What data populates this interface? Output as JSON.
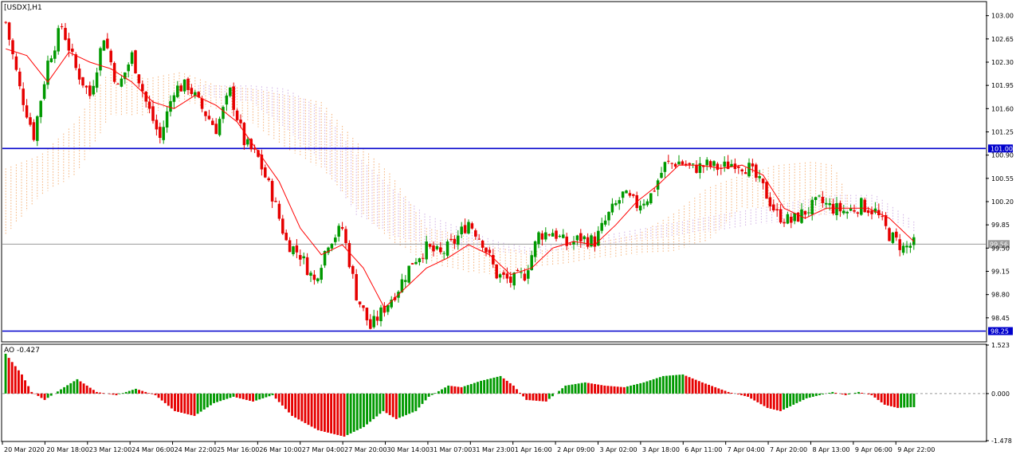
{
  "chart_data": [
    {
      "type": "candlestick",
      "title": "[USDX],H1",
      "ylim": [
        98.1,
        103.2
      ],
      "y_ticks": [
        103.0,
        102.65,
        102.3,
        101.95,
        101.6,
        101.25,
        100.9,
        100.55,
        100.2,
        99.85,
        99.5,
        99.15,
        98.8,
        98.45
      ],
      "y_tick_labels": [
        "103.00",
        "102.65",
        "102.30",
        "101.95",
        "101.60",
        "101.25",
        "100.90",
        "100.55",
        "100.20",
        "99.85",
        "99.50",
        "99.15",
        "98.80",
        "98.45"
      ],
      "x_labels": [
        "20 Mar 2020",
        "20 Mar 18:00",
        "23 Mar 12:00",
        "24 Mar 06:00",
        "24 Mar 22:00",
        "25 Mar 16:00",
        "26 Mar 10:00",
        "27 Mar 04:00",
        "27 Mar 20:00",
        "30 Mar 14:00",
        "31 Mar 07:00",
        "31 Mar 23:00",
        "1 Apr 16:00",
        "2 Apr 09:00",
        "3 Apr 02:00",
        "3 Apr 18:00",
        "6 Apr 11:00",
        "7 Apr 04:00",
        "7 Apr 20:00",
        "8 Apr 13:00",
        "9 Apr 06:00",
        "9 Apr 22:00"
      ],
      "horizontal_levels": [
        {
          "label": "101.00",
          "value": 101.0,
          "color": "#0000cc"
        },
        {
          "label": "98.25",
          "value": 98.25,
          "color": "#0000cc"
        }
      ],
      "current_price": {
        "label": "99.56",
        "value": 99.56
      },
      "colors": {
        "up": "#009900",
        "down": "#e60000",
        "ma": "#ff0000",
        "cloud_a": "#f4a460",
        "cloud_b": "#c8a2e0"
      },
      "close_path": [
        [
          0,
          102.9
        ],
        [
          4,
          101.9
        ],
        [
          8,
          101.2
        ],
        [
          12,
          102.3
        ],
        [
          16,
          102.85
        ],
        [
          20,
          102.2
        ],
        [
          24,
          101.8
        ],
        [
          28,
          102.7
        ],
        [
          32,
          101.9
        ],
        [
          36,
          102.4
        ],
        [
          40,
          101.7
        ],
        [
          44,
          101.15
        ],
        [
          48,
          101.9
        ],
        [
          52,
          101.95
        ],
        [
          56,
          101.6
        ],
        [
          60,
          101.3
        ],
        [
          64,
          101.85
        ],
        [
          68,
          101.1
        ],
        [
          72,
          100.85
        ],
        [
          76,
          100.3
        ],
        [
          80,
          99.6
        ],
        [
          84,
          99.4
        ],
        [
          88,
          99.0
        ],
        [
          92,
          99.6
        ],
        [
          96,
          99.8
        ],
        [
          100,
          98.8
        ],
        [
          104,
          98.3
        ],
        [
          108,
          98.6
        ],
        [
          112,
          98.9
        ],
        [
          116,
          99.3
        ],
        [
          120,
          99.5
        ],
        [
          124,
          99.4
        ],
        [
          128,
          99.6
        ],
        [
          132,
          99.9
        ],
        [
          136,
          99.6
        ],
        [
          140,
          99.1
        ],
        [
          144,
          99.0
        ],
        [
          148,
          99.1
        ],
        [
          152,
          99.7
        ],
        [
          156,
          99.75
        ],
        [
          160,
          99.55
        ],
        [
          164,
          99.65
        ],
        [
          168,
          99.6
        ],
        [
          172,
          100.0
        ],
        [
          176,
          100.3
        ],
        [
          180,
          100.15
        ],
        [
          184,
          100.3
        ],
        [
          188,
          100.75
        ],
        [
          192,
          100.8
        ],
        [
          196,
          100.7
        ],
        [
          200,
          100.75
        ],
        [
          204,
          100.7
        ],
        [
          208,
          100.8
        ],
        [
          212,
          100.7
        ],
        [
          216,
          100.4
        ],
        [
          220,
          100.0
        ],
        [
          224,
          99.9
        ],
        [
          228,
          100.05
        ],
        [
          232,
          100.2
        ],
        [
          236,
          100.1
        ],
        [
          240,
          100.05
        ],
        [
          244,
          100.15
        ],
        [
          248,
          100.05
        ],
        [
          252,
          99.7
        ],
        [
          256,
          99.5
        ],
        [
          259,
          99.56
        ]
      ],
      "ma_path": [
        [
          0,
          102.5
        ],
        [
          6,
          102.4
        ],
        [
          12,
          102.0
        ],
        [
          18,
          102.45
        ],
        [
          24,
          102.3
        ],
        [
          30,
          102.2
        ],
        [
          36,
          102.0
        ],
        [
          42,
          101.7
        ],
        [
          48,
          101.6
        ],
        [
          54,
          101.8
        ],
        [
          60,
          101.65
        ],
        [
          66,
          101.4
        ],
        [
          72,
          100.95
        ],
        [
          78,
          100.5
        ],
        [
          84,
          99.8
        ],
        [
          90,
          99.4
        ],
        [
          96,
          99.55
        ],
        [
          102,
          99.2
        ],
        [
          108,
          98.6
        ],
        [
          114,
          98.9
        ],
        [
          120,
          99.2
        ],
        [
          126,
          99.35
        ],
        [
          132,
          99.55
        ],
        [
          138,
          99.4
        ],
        [
          144,
          99.1
        ],
        [
          150,
          99.2
        ],
        [
          156,
          99.5
        ],
        [
          162,
          99.6
        ],
        [
          168,
          99.55
        ],
        [
          174,
          99.85
        ],
        [
          180,
          100.2
        ],
        [
          186,
          100.45
        ],
        [
          192,
          100.75
        ],
        [
          198,
          100.75
        ],
        [
          204,
          100.7
        ],
        [
          210,
          100.75
        ],
        [
          216,
          100.6
        ],
        [
          222,
          100.1
        ],
        [
          228,
          99.95
        ],
        [
          234,
          100.1
        ],
        [
          240,
          100.1
        ],
        [
          246,
          100.1
        ],
        [
          252,
          99.95
        ],
        [
          259,
          99.6
        ]
      ],
      "cloud_a_upper": [
        [
          0,
          100.7
        ],
        [
          10,
          100.9
        ],
        [
          20,
          101.4
        ],
        [
          30,
          102.2
        ],
        [
          40,
          102.05
        ],
        [
          50,
          102.15
        ],
        [
          60,
          101.95
        ],
        [
          70,
          101.9
        ],
        [
          80,
          101.8
        ],
        [
          90,
          101.7
        ],
        [
          100,
          101.1
        ],
        [
          110,
          100.6
        ],
        [
          120,
          99.8
        ],
        [
          130,
          99.7
        ],
        [
          140,
          99.5
        ],
        [
          150,
          99.45
        ],
        [
          160,
          99.5
        ],
        [
          170,
          99.6
        ],
        [
          180,
          99.7
        ],
        [
          190,
          100.0
        ],
        [
          200,
          100.4
        ],
        [
          210,
          100.6
        ],
        [
          220,
          100.75
        ],
        [
          230,
          100.8
        ],
        [
          236,
          100.75
        ],
        [
          240,
          100.3
        ]
      ],
      "cloud_a_lower": [
        [
          0,
          99.7
        ],
        [
          10,
          100.3
        ],
        [
          20,
          100.6
        ],
        [
          30,
          101.5
        ],
        [
          40,
          101.5
        ],
        [
          50,
          101.7
        ],
        [
          60,
          101.6
        ],
        [
          70,
          101.4
        ],
        [
          80,
          101.0
        ],
        [
          90,
          100.7
        ],
        [
          100,
          100.1
        ],
        [
          110,
          99.6
        ],
        [
          120,
          99.3
        ],
        [
          130,
          99.15
        ],
        [
          140,
          99.1
        ],
        [
          150,
          99.2
        ],
        [
          160,
          99.25
        ],
        [
          170,
          99.35
        ],
        [
          180,
          99.4
        ],
        [
          190,
          99.45
        ],
        [
          200,
          99.6
        ],
        [
          210,
          100.1
        ],
        [
          220,
          100.1
        ],
        [
          230,
          100.0
        ],
        [
          236,
          100.0
        ],
        [
          240,
          100.0
        ]
      ],
      "cloud_b_upper": [
        [
          55,
          101.95
        ],
        [
          70,
          101.95
        ],
        [
          80,
          101.9
        ],
        [
          90,
          101.6
        ],
        [
          100,
          100.9
        ],
        [
          110,
          100.4
        ],
        [
          120,
          100.0
        ],
        [
          130,
          99.8
        ],
        [
          140,
          99.6
        ],
        [
          150,
          99.5
        ],
        [
          236,
          100.3
        ],
        [
          248,
          100.3
        ],
        [
          259,
          99.9
        ]
      ],
      "cloud_b_lower": [
        [
          55,
          101.8
        ],
        [
          70,
          101.7
        ],
        [
          80,
          101.3
        ],
        [
          90,
          100.8
        ],
        [
          100,
          100.0
        ],
        [
          110,
          99.7
        ],
        [
          120,
          99.55
        ],
        [
          130,
          99.5
        ],
        [
          140,
          99.45
        ],
        [
          150,
          99.4
        ],
        [
          236,
          100.0
        ],
        [
          248,
          100.05
        ],
        [
          259,
          99.75
        ]
      ]
    },
    {
      "type": "bar",
      "title": "AO -0.427",
      "ylim": [
        -1.478,
        1.523
      ],
      "y_tick_labels": [
        "1.523",
        "0.000",
        "-1.478"
      ],
      "y_ticks": [
        1.523,
        0.0,
        -1.478
      ],
      "zero_line": 0.0,
      "last_value": -0.427,
      "colors": {
        "up": "#009900",
        "down": "#e60000"
      },
      "values_path": [
        [
          0,
          1.25
        ],
        [
          5,
          0.6
        ],
        [
          8,
          0.05
        ],
        [
          12,
          -0.2
        ],
        [
          18,
          0.2
        ],
        [
          22,
          0.45
        ],
        [
          28,
          0.05
        ],
        [
          34,
          -0.05
        ],
        [
          40,
          0.15
        ],
        [
          46,
          -0.05
        ],
        [
          52,
          -0.55
        ],
        [
          58,
          -0.7
        ],
        [
          64,
          -0.3
        ],
        [
          70,
          -0.1
        ],
        [
          76,
          -0.25
        ],
        [
          82,
          -0.05
        ],
        [
          88,
          -0.7
        ],
        [
          96,
          -1.15
        ],
        [
          104,
          -1.35
        ],
        [
          110,
          -1.05
        ],
        [
          116,
          -0.55
        ],
        [
          120,
          -0.8
        ],
        [
          126,
          -0.55
        ],
        [
          130,
          -0.1
        ],
        [
          136,
          0.25
        ],
        [
          140,
          0.2
        ],
        [
          146,
          0.4
        ],
        [
          152,
          0.55
        ],
        [
          156,
          0.25
        ],
        [
          160,
          -0.2
        ],
        [
          166,
          -0.25
        ],
        [
          172,
          0.25
        ],
        [
          178,
          0.35
        ],
        [
          184,
          0.25
        ],
        [
          190,
          0.2
        ],
        [
          196,
          0.35
        ],
        [
          202,
          0.55
        ],
        [
          208,
          0.6
        ],
        [
          214,
          0.35
        ],
        [
          218,
          0.2
        ],
        [
          222,
          0.05
        ],
        [
          228,
          -0.1
        ],
        [
          234,
          -0.45
        ],
        [
          238,
          -0.55
        ],
        [
          242,
          -0.35
        ],
        [
          246,
          -0.15
        ],
        [
          250,
          -0.05
        ],
        [
          254,
          0.05
        ],
        [
          258,
          -0.05
        ],
        [
          262,
          0.05
        ],
        [
          266,
          -0.05
        ],
        [
          270,
          -0.35
        ],
        [
          274,
          -0.45
        ],
        [
          278,
          -0.427
        ]
      ]
    }
  ]
}
